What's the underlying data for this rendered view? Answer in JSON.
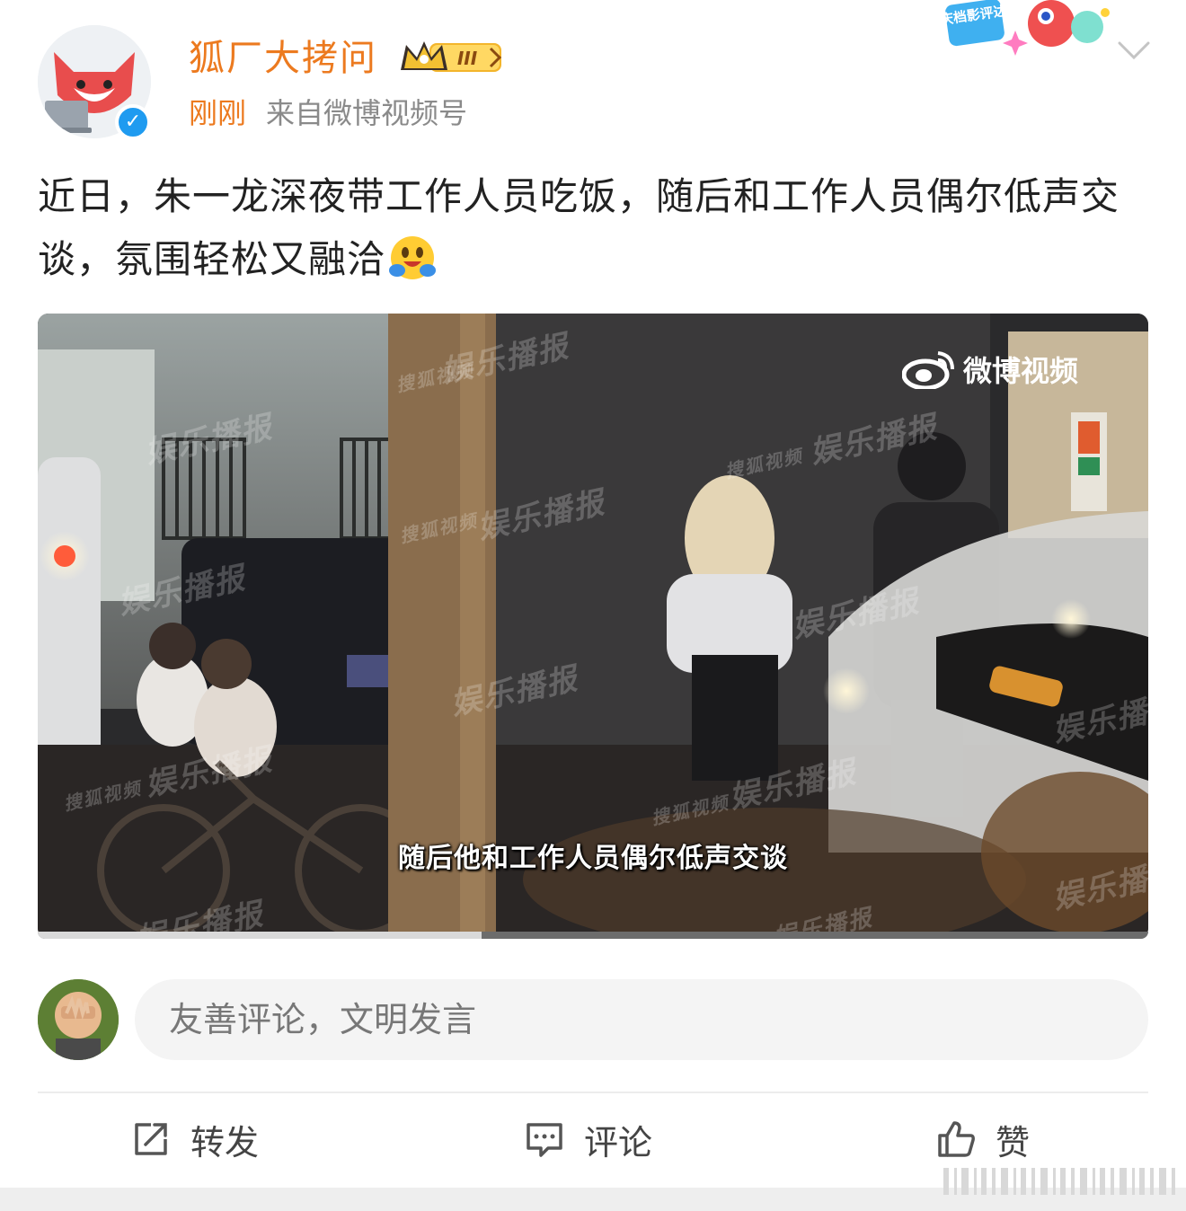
{
  "header": {
    "username": "狐厂大拷问",
    "level_badge": "III",
    "time": "刚刚",
    "source": "来自微博视频号",
    "event_badge": "国庆档影评达人",
    "icons": [
      "avatar",
      "verified-icon",
      "crown-badge-icon",
      "chevron-down-icon"
    ]
  },
  "post": {
    "text": "近日，朱一龙深夜带工作人员吃饭，随后和工作人员偶尔低声交谈，氛围轻松又融洽",
    "emoji": "hug-emoji"
  },
  "video": {
    "subtitle": "随后他和工作人员偶尔低声交谈",
    "logo_text": "微博视频",
    "watermark": "娱乐播报",
    "watermark_small": "搜狐视频",
    "progress": 0.4
  },
  "comment": {
    "placeholder": "友善评论，文明发言"
  },
  "actions": {
    "repost": "转发",
    "comment": "评论",
    "like": "赞"
  },
  "colors": {
    "accent_orange": "#ec7a1f",
    "verified_blue": "#1f9bf0",
    "text": "#222222",
    "muted": "#8a8a8a"
  }
}
